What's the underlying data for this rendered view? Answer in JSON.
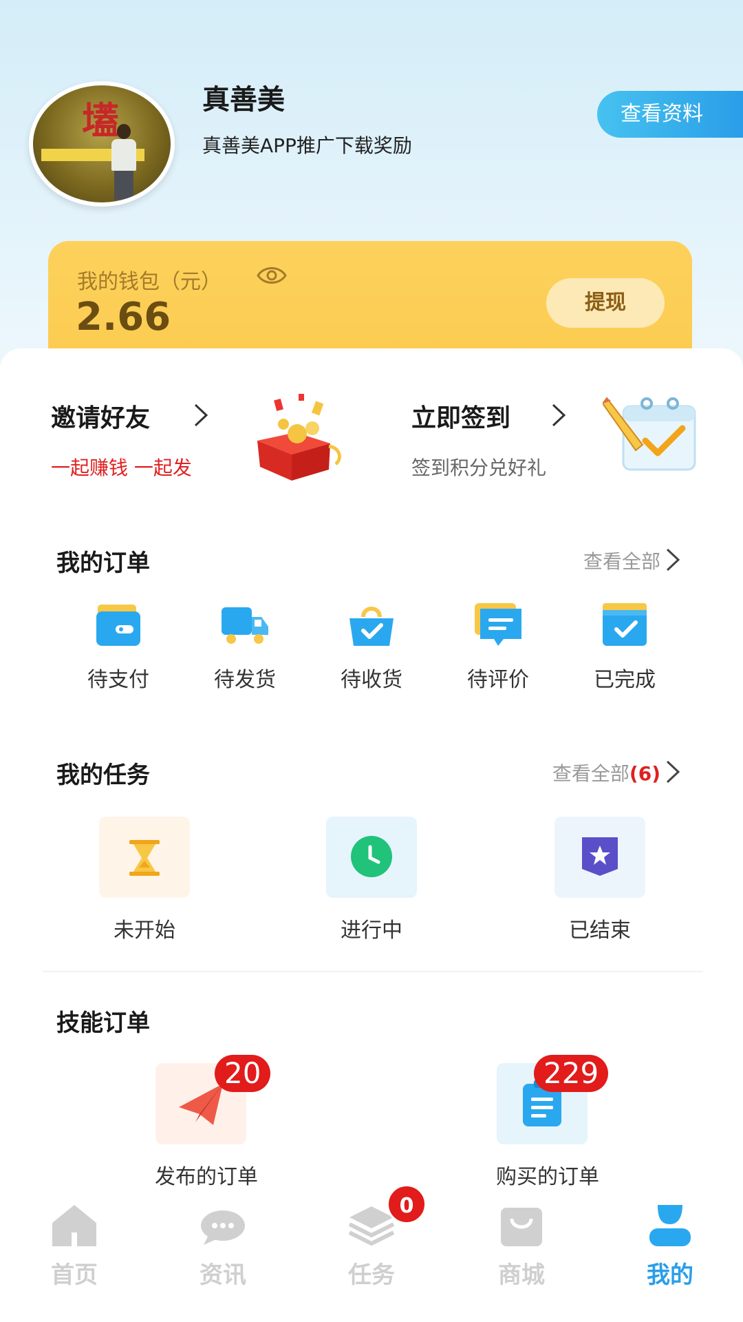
{
  "profile": {
    "name": "真善美",
    "subtitle": "真善美APP推广下载奖励",
    "view_profile_label": "查看资料"
  },
  "wallet": {
    "label": "我的钱包（元）",
    "amount": "2.66",
    "withdraw_label": "提现"
  },
  "promos": {
    "invite": {
      "title": "邀请好友",
      "subtitle": "一起赚钱 一起发",
      "icon": "gift-box-icon"
    },
    "signin": {
      "title": "立即签到",
      "subtitle": "签到积分兑好礼",
      "icon": "calendar-check-icon"
    }
  },
  "orders": {
    "title": "我的订单",
    "view_all": "查看全部",
    "items": [
      {
        "label": "待支付",
        "icon": "wallet-icon"
      },
      {
        "label": "待发货",
        "icon": "truck-icon"
      },
      {
        "label": "待收货",
        "icon": "bag-check-icon"
      },
      {
        "label": "待评价",
        "icon": "comment-icon"
      },
      {
        "label": "已完成",
        "icon": "folder-check-icon"
      }
    ]
  },
  "tasks": {
    "title": "我的任务",
    "view_all": "查看全部",
    "view_all_count": "(6)",
    "items": [
      {
        "label": "未开始",
        "icon": "hourglass-icon"
      },
      {
        "label": "进行中",
        "icon": "clock-icon"
      },
      {
        "label": "已结束",
        "icon": "star-badge-icon"
      }
    ]
  },
  "skills": {
    "title": "技能订单",
    "items": [
      {
        "label": "发布的订单",
        "badge": "20",
        "icon": "paper-plane-icon"
      },
      {
        "label": "购买的订单",
        "badge": "229",
        "icon": "clipboard-icon"
      }
    ]
  },
  "tabbar": {
    "items": [
      {
        "label": "首页",
        "icon": "home-icon"
      },
      {
        "label": "资讯",
        "icon": "chat-icon"
      },
      {
        "label": "任务",
        "icon": "stack-icon",
        "badge": "0"
      },
      {
        "label": "商城",
        "icon": "shopping-bag-icon"
      },
      {
        "label": "我的",
        "icon": "user-icon",
        "active": true
      }
    ]
  },
  "colors": {
    "accent": "#2a9ee8",
    "wallet": "#fbcb4f",
    "badge": "#e21b1b",
    "promo_red": "#e02020"
  }
}
